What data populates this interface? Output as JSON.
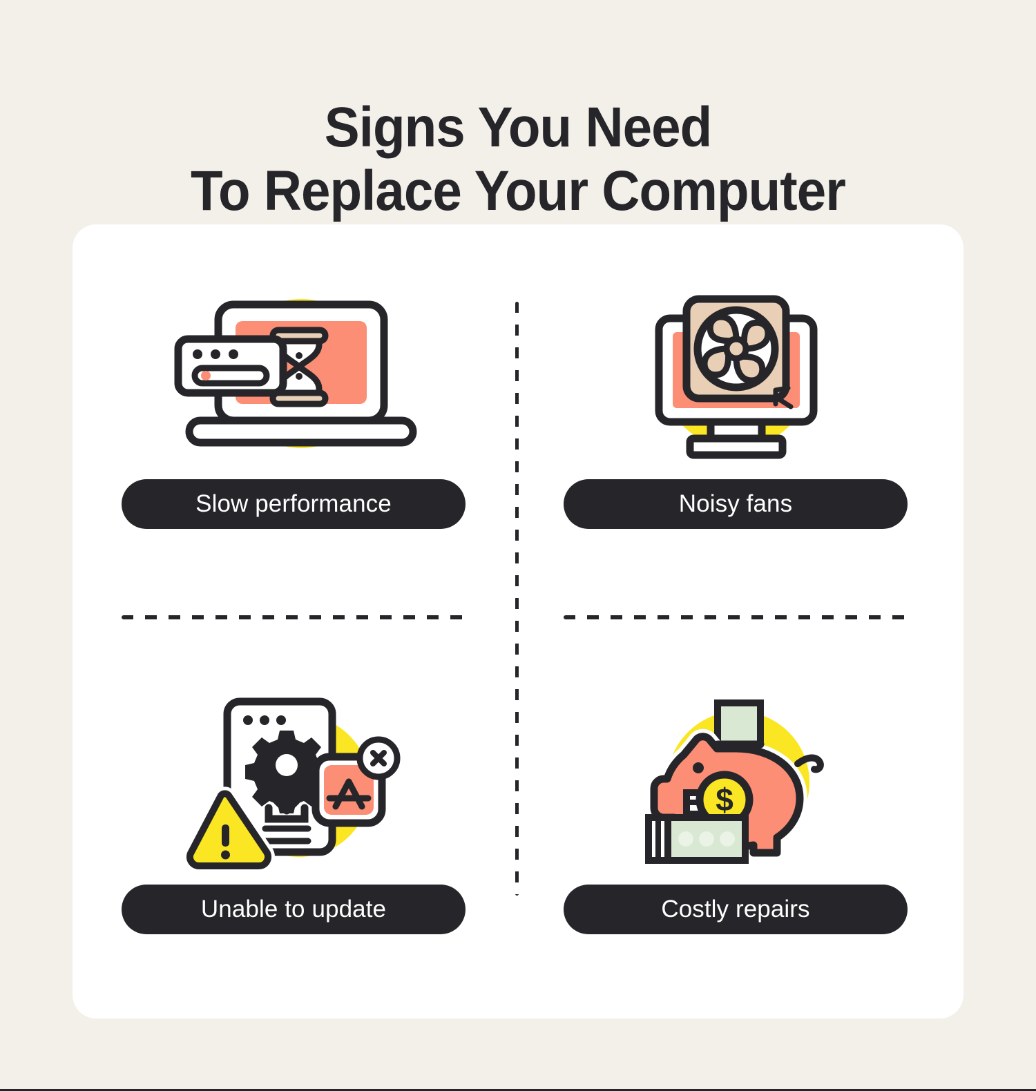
{
  "title": {
    "line1": "Signs You Need",
    "line2": "To Replace Your Computer"
  },
  "colors": {
    "background": "#f3efe9",
    "card": "#ffffff",
    "ink": "#26262a",
    "salmon": "#fb8e75",
    "yellow": "#fae622",
    "tan": "#e8cfb5",
    "money_green": "#d9e8d2",
    "pill_text": "#ffffff"
  },
  "items": [
    {
      "id": "slow-performance",
      "label": "Slow performance",
      "icon": "laptop-hourglass-icon"
    },
    {
      "id": "noisy-fans",
      "label": "Noisy fans",
      "icon": "monitor-fan-icon"
    },
    {
      "id": "unable-to-update",
      "label": "Unable to update",
      "icon": "update-failure-icon"
    },
    {
      "id": "costly-repairs",
      "label": "Costly repairs",
      "icon": "piggy-bank-icon"
    }
  ]
}
